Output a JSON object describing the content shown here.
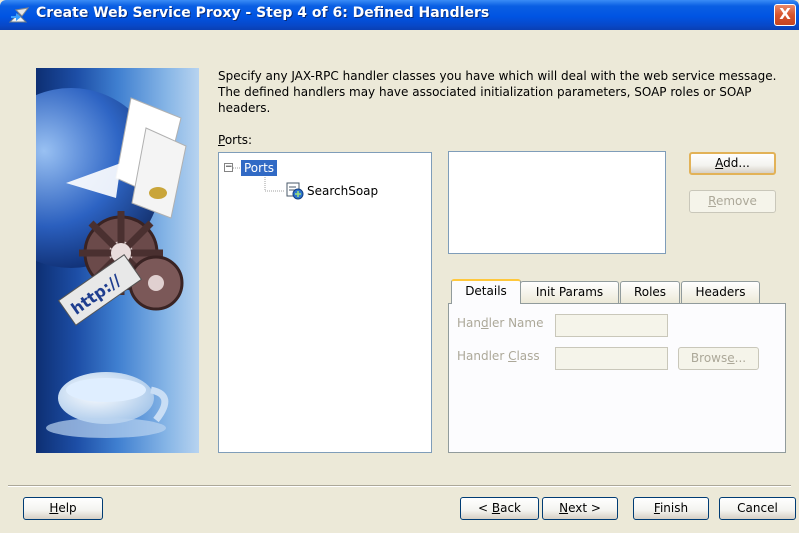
{
  "window": {
    "title": "Create Web Service Proxy - Step 4 of 6: Defined Handlers",
    "close_label": "X"
  },
  "description": "Specify any JAX-RPC handler classes you have which will deal with the web service message. The defined handlers may have associated initialization parameters, SOAP roles or SOAP headers.",
  "ports": {
    "label_mnemonic": "P",
    "label_rest": "orts:",
    "tree": {
      "root_toggle": "−",
      "root_label": "Ports",
      "children": [
        "SearchSoap"
      ]
    }
  },
  "handlers": {
    "add": {
      "mnemonic": "A",
      "rest": "dd..."
    },
    "remove": {
      "mnemonic": "R",
      "rest": "emove"
    }
  },
  "tabs": [
    "Details",
    "Init Params",
    "Roles",
    "Headers"
  ],
  "details": {
    "handler_name": {
      "pre": "Han",
      "mnemonic": "d",
      "post": "ler Name",
      "value": ""
    },
    "handler_class": {
      "pre": "Handler ",
      "mnemonic": "C",
      "post": "lass",
      "value": ""
    },
    "browse": {
      "pre": "Brows",
      "mnemonic": "e",
      "post": "..."
    }
  },
  "footer": {
    "help": {
      "mnemonic": "H",
      "rest": "elp"
    },
    "back": {
      "pre": "< ",
      "mnemonic": "B",
      "post": "ack"
    },
    "next": {
      "mnemonic": "N",
      "post": "ext >"
    },
    "finish": {
      "mnemonic": "F",
      "post": "inish"
    },
    "cancel": "Cancel"
  },
  "banner": {
    "text": "http://"
  }
}
